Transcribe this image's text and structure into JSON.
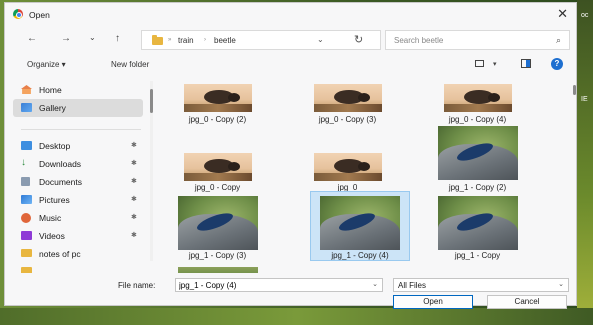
{
  "window": {
    "title": "Open",
    "close_glyph": "✕"
  },
  "nav": {
    "back_glyph": "←",
    "forward_glyph": "→",
    "recent_glyph": "⌄",
    "up_glyph": "↑",
    "breadcrumb_sep_glyph": "»",
    "breadcrumb": [
      "train",
      "beetle"
    ],
    "crumb_sep": "›",
    "dropdown_glyph": "⌄",
    "refresh_glyph": "↻"
  },
  "search": {
    "placeholder": "Search beetle",
    "icon_glyph": "⌕"
  },
  "toolbar": {
    "organize": "Organize ▾",
    "new_folder": "New folder",
    "view_dd": "▾",
    "help_glyph": "?"
  },
  "sidebar": {
    "items": [
      {
        "label": "Home",
        "icon": "home-icon",
        "selected": false
      },
      {
        "label": "Gallery",
        "icon": "gallery-icon",
        "selected": true
      },
      {
        "label": "Desktop",
        "icon": "desktop-icon",
        "pinned": true
      },
      {
        "label": "Downloads",
        "icon": "downloads-icon",
        "pinned": true
      },
      {
        "label": "Documents",
        "icon": "documents-icon",
        "pinned": true
      },
      {
        "label": "Pictures",
        "icon": "pictures-icon",
        "pinned": true
      },
      {
        "label": "Music",
        "icon": "music-icon",
        "pinned": true
      },
      {
        "label": "Videos",
        "icon": "videos-icon",
        "pinned": true
      },
      {
        "label": "notes of pc",
        "icon": "folder-icon",
        "pinned": false
      }
    ],
    "pin_glyph": "✱"
  },
  "files": [
    {
      "name": "jpg_0 - Copy (2)",
      "type": "beetle1",
      "selected": false
    },
    {
      "name": "jpg_0 - Copy (3)",
      "type": "beetle1",
      "selected": false
    },
    {
      "name": "jpg_0 - Copy (4)",
      "type": "beetle1",
      "selected": false
    },
    {
      "name": "jpg_0 - Copy",
      "type": "beetle1",
      "selected": false
    },
    {
      "name": "jpg_0",
      "type": "beetle1",
      "selected": false
    },
    {
      "name": "jpg_1 - Copy (2)",
      "type": "beetle2",
      "selected": false
    },
    {
      "name": "jpg_1 - Copy (3)",
      "type": "beetle2",
      "selected": false
    },
    {
      "name": "jpg_1 - Copy (4)",
      "type": "beetle2",
      "selected": true
    },
    {
      "name": "jpg_1 - Copy",
      "type": "beetle2",
      "selected": false
    }
  ],
  "footer": {
    "file_name_label": "File name:",
    "file_name_value": "jpg_1 - Copy (4)",
    "filter_value": "All Files",
    "dropdown_glyph": "⌄",
    "open_label": "Open",
    "cancel_label": "Cancel"
  },
  "background": {
    "right_edge_text": [
      "oc",
      "IE"
    ]
  },
  "colors": {
    "accent": "#0067c0",
    "selection": "#cce4f7",
    "folder": "#e8b640"
  }
}
